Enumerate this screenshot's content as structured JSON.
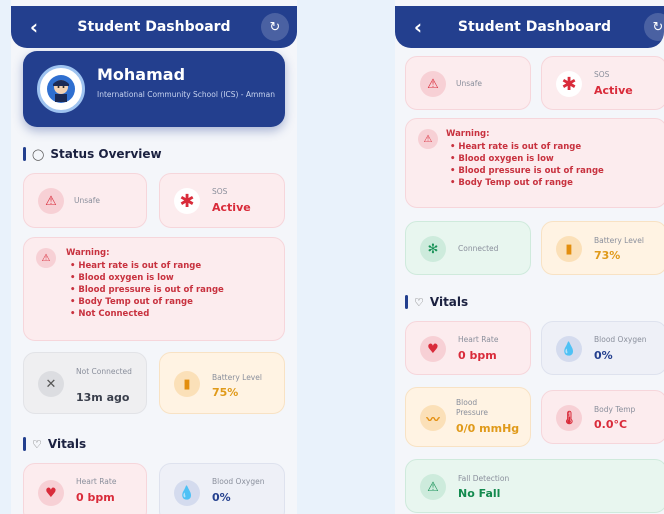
{
  "left": {
    "header": {
      "title": "Student Dashboard"
    },
    "profile": {
      "name": "Mohamad",
      "school": "International Community School (ICS) - Amman"
    },
    "status_section": "Status Overview",
    "status": {
      "safety": "Unsafe",
      "sos_label": "SOS",
      "sos_value": "Active"
    },
    "warning": {
      "title": "Warning:",
      "items": [
        "Heart rate is out of range",
        "Blood oxygen is low",
        "Blood pressure is out of range",
        "Body Temp out of range",
        "Not Connected"
      ]
    },
    "connection": {
      "label": "Not Connected",
      "time": "13m ago"
    },
    "battery": {
      "label": "Battery Level",
      "value": "75%"
    },
    "vitals_section": "Vitals",
    "vitals": {
      "heart_label": "Heart Rate",
      "heart_value": "0 bpm",
      "oxygen_label": "Blood Oxygen",
      "oxygen_value": "0%"
    }
  },
  "right": {
    "header": {
      "title": "Student Dashboard"
    },
    "status": {
      "safety": "Unsafe",
      "sos_label": "SOS",
      "sos_value": "Active"
    },
    "warning": {
      "title": "Warning:",
      "items": [
        "Heart rate is out of range",
        "Blood oxygen is low",
        "Blood pressure is out of range",
        "Body Temp out of range"
      ]
    },
    "connection": {
      "label": "Connected"
    },
    "battery": {
      "label": "Battery Level",
      "value": "73%"
    },
    "vitals_section": "Vitals",
    "vitals": {
      "heart_label": "Heart Rate",
      "heart_value": "0 bpm",
      "oxygen_label": "Blood Oxygen",
      "oxygen_value": "0%",
      "bp_label": "Blood Pressure",
      "bp_value": "0/0 mmHg",
      "temp_label": "Body Temp",
      "temp_value": "0.0°C",
      "fall_label": "Fall Detection",
      "fall_value": "No Fall"
    }
  },
  "icons": {
    "back": "chevron-left-icon",
    "refresh": "refresh-icon",
    "shield": "shield-icon",
    "heart": "heart-icon",
    "alert": "alert-triangle-icon",
    "sos": "asterisk-icon",
    "bluetooth": "bluetooth-icon",
    "battery": "battery-icon",
    "drop": "drop-icon",
    "bp": "blood-pressure-icon",
    "thermometer": "thermometer-icon"
  },
  "colors": {
    "primary": "#233f8e",
    "danger": "#d92b3a",
    "warning": "#e09a1a",
    "success": "#138a4e"
  }
}
